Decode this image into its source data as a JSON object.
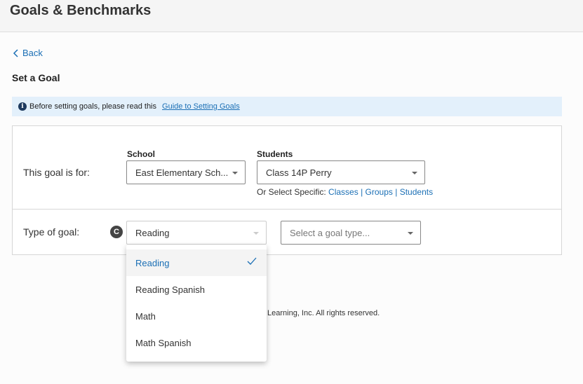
{
  "header": {
    "title": "Goals & Benchmarks"
  },
  "nav": {
    "back_label": "Back"
  },
  "page": {
    "title": "Set a Goal"
  },
  "banner": {
    "text": "Before setting goals, please read this",
    "link": "Guide to Setting Goals"
  },
  "goal_for": {
    "label": "This goal is for:",
    "school_label": "School",
    "school_value": "East Elementary Sch...",
    "students_label": "Students",
    "students_value": "Class 14P Perry",
    "specific_prefix": "Or Select Specific:",
    "links": [
      "Classes",
      "Groups",
      "Students"
    ],
    "sep": "|"
  },
  "goal_type": {
    "label": "Type of goal:",
    "badge": "C",
    "subject_value": "Reading",
    "type_placeholder": "Select a goal type..."
  },
  "dropdown": {
    "options": [
      {
        "label": "Reading",
        "selected": true
      },
      {
        "label": "Reading Spanish"
      },
      {
        "label": "Math"
      },
      {
        "label": "Math Spanish"
      }
    ]
  },
  "footer": {
    "text": "Learning, Inc. All rights reserved."
  },
  "colors": {
    "accent": "#1b6fb5",
    "banner_bg": "#e3f0fb"
  }
}
